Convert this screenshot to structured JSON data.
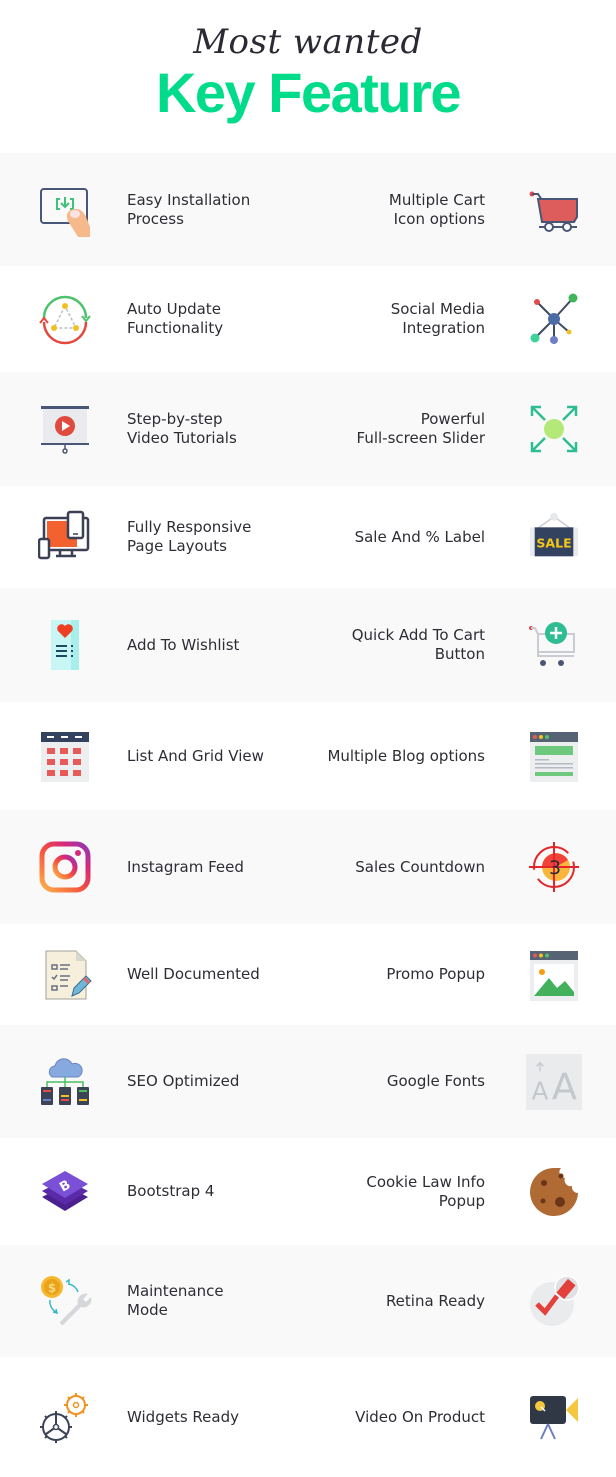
{
  "header": {
    "script_title": "Most wanted",
    "main_title": "Key Feature"
  },
  "colors": {
    "accent": "#00dc8a",
    "text": "#2d2d35",
    "row_alt": "#f9f9f9"
  },
  "rows": [
    {
      "left": {
        "label": "Easy Installation\nProcess",
        "icon": "touch-install-icon"
      },
      "right": {
        "label": "Multiple Cart\nIcon options",
        "icon": "shopping-cart-icon"
      }
    },
    {
      "left": {
        "label": "Auto Update\nFunctionality",
        "icon": "auto-update-cycle-icon"
      },
      "right": {
        "label": "Social Media\nIntegration",
        "icon": "network-share-icon"
      }
    },
    {
      "left": {
        "label": "Step-by-step\nVideo Tutorials",
        "icon": "video-presentation-icon"
      },
      "right": {
        "label": "Powerful\nFull-screen Slider",
        "icon": "fullscreen-expand-icon"
      }
    },
    {
      "left": {
        "label": "Fully Responsive\nPage Layouts",
        "icon": "responsive-devices-icon"
      },
      "right": {
        "label": "Sale And % Label",
        "icon": "sale-sign-icon"
      }
    },
    {
      "left": {
        "label": "Add To Wishlist",
        "icon": "wishlist-heart-icon"
      },
      "right": {
        "label": "Quick Add To Cart\nButton",
        "icon": "cart-add-icon"
      }
    },
    {
      "left": {
        "label": "List And Grid View",
        "icon": "grid-view-icon"
      },
      "right": {
        "label": "Multiple Blog options",
        "icon": "blog-layout-icon"
      }
    },
    {
      "left": {
        "label": "Instagram Feed",
        "icon": "instagram-icon"
      },
      "right": {
        "label": "Sales Countdown",
        "icon": "countdown-target-icon"
      }
    },
    {
      "left": {
        "label": "Well Documented",
        "icon": "document-checklist-icon"
      },
      "right": {
        "label": "Promo Popup",
        "icon": "image-popup-icon"
      }
    },
    {
      "left": {
        "label": "SEO Optimized",
        "icon": "cloud-servers-icon"
      },
      "right": {
        "label": "Google Fonts",
        "icon": "font-size-icon"
      }
    },
    {
      "left": {
        "label": "Bootstrap 4",
        "icon": "bootstrap-icon"
      },
      "right": {
        "label": "Cookie Law Info\nPopup",
        "icon": "cookie-icon"
      }
    },
    {
      "left": {
        "label": "Maintenance\nMode",
        "icon": "maintenance-wrench-icon"
      },
      "right": {
        "label": "Retina Ready",
        "icon": "retina-check-icon"
      }
    },
    {
      "left": {
        "label": "Widgets Ready",
        "icon": "gears-icon"
      },
      "right": {
        "label": "Video On Product",
        "icon": "video-camera-icon"
      }
    }
  ]
}
